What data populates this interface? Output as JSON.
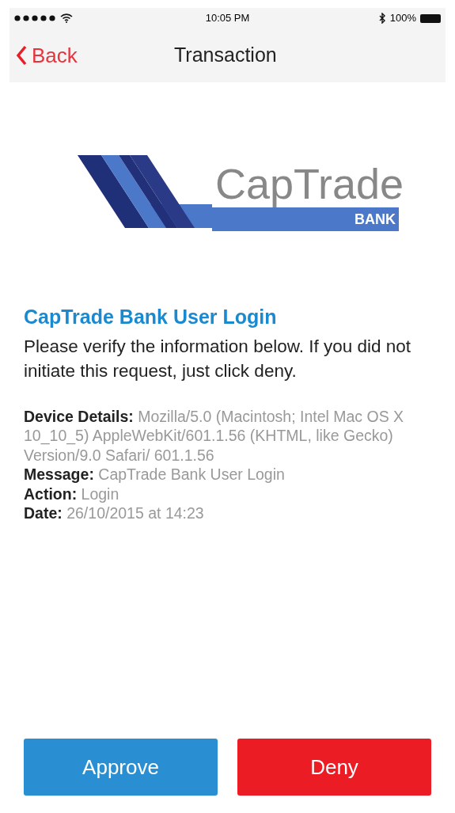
{
  "status_bar": {
    "time": "10:05 PM",
    "battery": "100%"
  },
  "nav": {
    "back": "Back",
    "title": "Transaction"
  },
  "logo": {
    "name": "CapTrade",
    "sub": "BANK"
  },
  "heading": "CapTrade Bank User Login",
  "intro": "Please verify the information below. If you did not initiate this request, just click deny.",
  "details": [
    "**Device Details:** Mozilla/5.0 (Macintosh; Intel Mac OS X 10_10_5) AppleWebKit/601.1.56 (KHTML, like Gecko) Version/9.0 Safari/ 601.1.56",
    "**Message:** CapTrade Bank User Login",
    "**Action:** Login",
    "**Date:** 26/10/2015 at 14:23"
  ],
  "buttons": [
    {
      "label": "Approve",
      "kind": "approve"
    },
    {
      "label": "Deny",
      "kind": "deny"
    }
  ]
}
